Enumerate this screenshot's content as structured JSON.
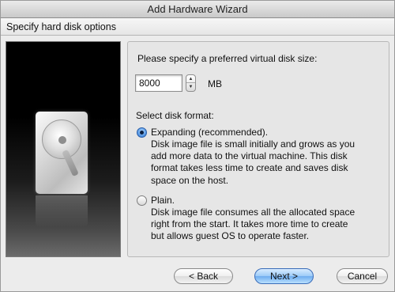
{
  "window": {
    "title": "Add Hardware Wizard"
  },
  "header": {
    "title": "Specify hard disk options"
  },
  "size": {
    "prompt": "Please specify a preferred virtual disk size:",
    "value": "8000",
    "unit": "MB"
  },
  "format": {
    "prompt": "Select disk format:",
    "options": [
      {
        "label": "Expanding (recommended).",
        "selected": true,
        "lines": [
          "Disk image file is small initially and grows as you",
          "add more data to the virtual machine. This disk",
          "format takes less time to create and saves disk",
          "space on the host."
        ]
      },
      {
        "label": "Plain.",
        "selected": false,
        "lines": [
          "Disk image file consumes all the allocated space",
          "right from the start. It takes more time to create",
          "but allows guest OS to operate faster."
        ]
      }
    ]
  },
  "buttons": {
    "back": "< Back",
    "next": "Next >",
    "cancel": "Cancel"
  },
  "icons": {
    "image": "hard-drive-icon",
    "stepper": "stepper-arrows-icon"
  },
  "colors": {
    "accent": "#5f9fe8",
    "default_button": "#6eacef"
  }
}
